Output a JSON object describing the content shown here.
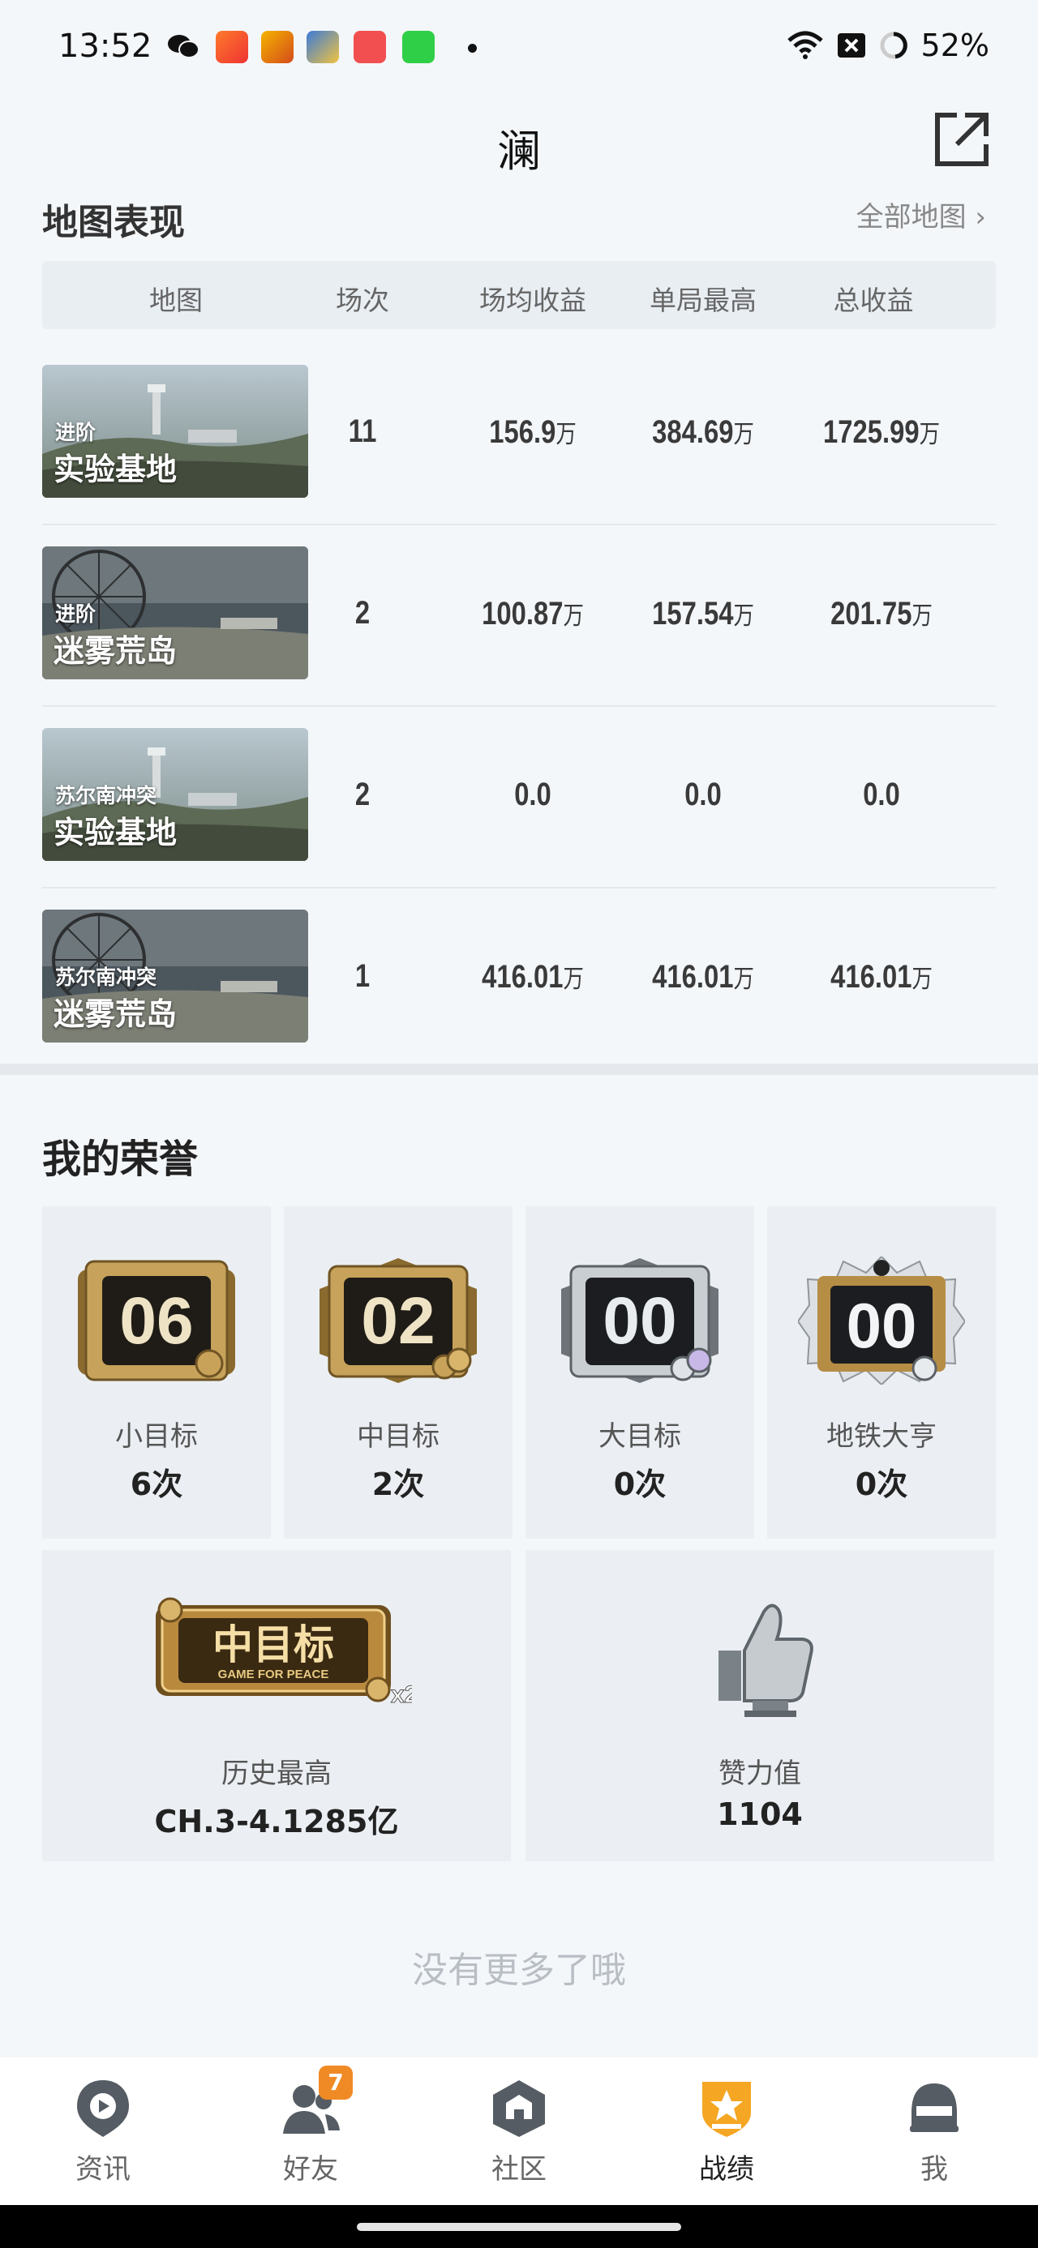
{
  "status_bar": {
    "time": "13:52",
    "battery": "52%"
  },
  "header": {
    "title": "澜"
  },
  "map_section": {
    "title": "地图表现",
    "all_maps_link": "全部地图",
    "columns": [
      "地图",
      "场次",
      "场均收益",
      "单局最高",
      "总收益"
    ],
    "rows": [
      {
        "mode": "进阶",
        "map": "实验基地",
        "matches": "11",
        "avg": "156.9",
        "avg_unit": "万",
        "best": "384.69",
        "best_unit": "万",
        "total": "1725.99",
        "total_unit": "万"
      },
      {
        "mode": "进阶",
        "map": "迷雾荒岛",
        "matches": "2",
        "avg": "100.87",
        "avg_unit": "万",
        "best": "157.54",
        "best_unit": "万",
        "total": "201.75",
        "total_unit": "万"
      },
      {
        "mode": "苏尔南冲突",
        "map": "实验基地",
        "matches": "2",
        "avg": "0.0",
        "avg_unit": "",
        "best": "0.0",
        "best_unit": "",
        "total": "0.0",
        "total_unit": ""
      },
      {
        "mode": "苏尔南冲突",
        "map": "迷雾荒岛",
        "matches": "1",
        "avg": "416.01",
        "avg_unit": "万",
        "best": "416.01",
        "best_unit": "万",
        "total": "416.01",
        "total_unit": "万"
      }
    ]
  },
  "honor": {
    "title": "我的荣誉",
    "cards": [
      {
        "badge_num": "06",
        "label": "小目标",
        "value": "6次"
      },
      {
        "badge_num": "02",
        "label": "中目标",
        "value": "2次"
      },
      {
        "badge_num": "00",
        "label": "大目标",
        "value": "0次"
      },
      {
        "badge_num": "00",
        "label": "地铁大亨",
        "value": "0次"
      }
    ],
    "best": {
      "badge_text": "中目标",
      "badge_sub": "GAME FOR PEACE",
      "multiplier": "x2",
      "label": "历史最高",
      "value": "CH.3-4.1285亿"
    },
    "likes": {
      "label": "赞力值",
      "value": "1104"
    }
  },
  "footer_text": "没有更多了哦",
  "bottom_nav": [
    {
      "label": "资讯",
      "icon": "news-icon"
    },
    {
      "label": "好友",
      "icon": "friends-icon",
      "badge": "7"
    },
    {
      "label": "社区",
      "icon": "community-icon"
    },
    {
      "label": "战绩",
      "icon": "record-icon",
      "active": true
    },
    {
      "label": "我",
      "icon": "profile-icon"
    }
  ],
  "colors": {
    "accent": "#f5a623",
    "badge_orange": "#f08a24",
    "bg": "#f4f7fa"
  }
}
